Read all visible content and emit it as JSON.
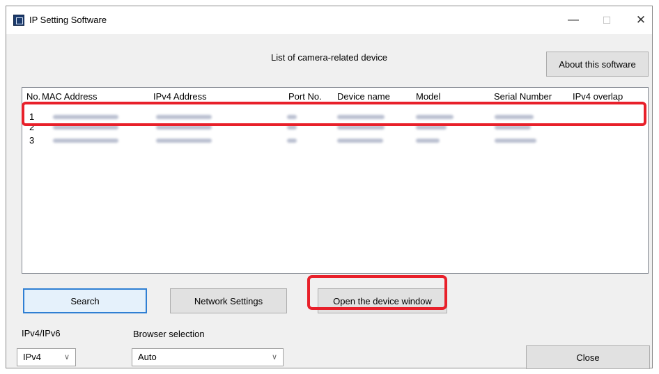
{
  "window": {
    "title": "IP Setting Software",
    "controls": {
      "minimize": "—",
      "maximize": "☐",
      "close": "✕"
    }
  },
  "main": {
    "list_caption": "List of camera-related device",
    "about_button": "About this software",
    "columns": [
      "No.",
      "MAC Address",
      "IPv4 Address",
      "Port No.",
      "Device name",
      "Model",
      "Serial Number",
      "IPv4 overlap"
    ],
    "rows": [
      {
        "no": "1"
      },
      {
        "no": "2"
      },
      {
        "no": "3"
      }
    ]
  },
  "buttons": {
    "search": "Search",
    "network_settings": "Network Settings",
    "open_device_window": "Open the device window",
    "close": "Close"
  },
  "settings": {
    "ip_version_label": "IPv4/IPv6",
    "ip_version_value": "IPv4",
    "browser_label": "Browser selection",
    "browser_value": "Auto"
  },
  "annotations": {
    "highlight_color": "#e8202a"
  }
}
